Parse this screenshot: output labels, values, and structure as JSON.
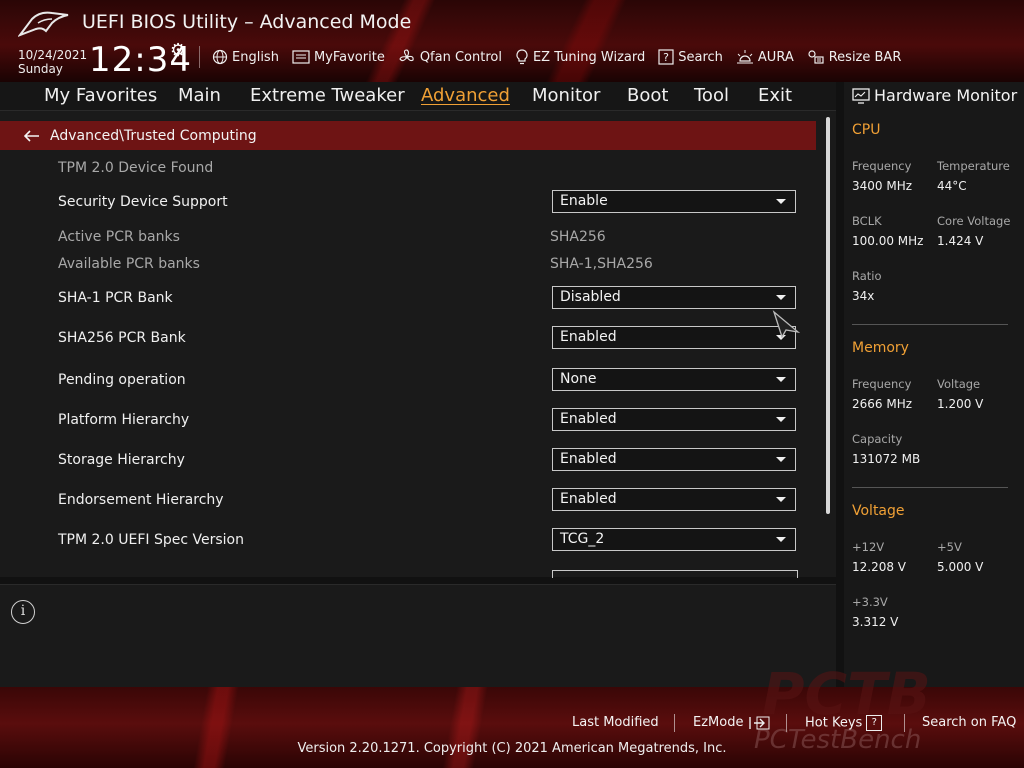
{
  "header": {
    "title": "UEFI BIOS Utility – Advanced Mode",
    "date": "10/24/2021",
    "day": "Sunday",
    "time": "12:34",
    "toolbar": [
      {
        "label": "English",
        "icon": "globe-icon"
      },
      {
        "label": "MyFavorite",
        "icon": "favorite-list-icon"
      },
      {
        "label": "Qfan Control",
        "icon": "fan-icon"
      },
      {
        "label": "EZ Tuning Wizard",
        "icon": "lightbulb-icon"
      },
      {
        "label": "Search",
        "icon": "help-search-icon"
      },
      {
        "label": "AURA",
        "icon": "aura-light-icon"
      },
      {
        "label": "Resize BAR",
        "icon": "resize-bar-icon"
      }
    ]
  },
  "tabs": [
    "My Favorites",
    "Main",
    "Extreme Tweaker",
    "Advanced",
    "Monitor",
    "Boot",
    "Tool",
    "Exit"
  ],
  "active_tab": "Advanced",
  "breadcrumb": "Advanced\\Trusted Computing",
  "settings": {
    "tpm_found": "TPM 2.0 Device Found",
    "security_device_support": {
      "label": "Security Device Support",
      "value": "Enable"
    },
    "active_pcr_banks": {
      "label": "Active PCR banks",
      "value": "SHA256"
    },
    "available_pcr_banks": {
      "label": "Available PCR banks",
      "value": "SHA-1,SHA256"
    },
    "sha1_pcr_bank": {
      "label": "SHA-1 PCR Bank",
      "value": "Disabled"
    },
    "sha256_pcr_bank": {
      "label": "SHA256 PCR Bank",
      "value": "Enabled"
    },
    "pending_operation": {
      "label": "Pending operation",
      "value": "None"
    },
    "platform_hierarchy": {
      "label": "Platform Hierarchy",
      "value": "Enabled"
    },
    "storage_hierarchy": {
      "label": "Storage Hierarchy",
      "value": "Enabled"
    },
    "endorsement_hierarchy": {
      "label": "Endorsement Hierarchy",
      "value": "Enabled"
    },
    "tpm_uefi_spec_version": {
      "label": "TPM 2.0 UEFI Spec Version",
      "value": "TCG_2"
    }
  },
  "hardware_monitor": {
    "title": "Hardware Monitor",
    "cpu": {
      "heading": "CPU",
      "frequency_label": "Frequency",
      "frequency": "3400 MHz",
      "temperature_label": "Temperature",
      "temperature": "44°C",
      "bclk_label": "BCLK",
      "bclk": "100.00 MHz",
      "core_voltage_label": "Core Voltage",
      "core_voltage": "1.424 V",
      "ratio_label": "Ratio",
      "ratio": "34x"
    },
    "memory": {
      "heading": "Memory",
      "frequency_label": "Frequency",
      "frequency": "2666 MHz",
      "voltage_label": "Voltage",
      "voltage": "1.200 V",
      "capacity_label": "Capacity",
      "capacity": "131072 MB"
    },
    "voltage": {
      "heading": "Voltage",
      "v12_label": "+12V",
      "v12": "12.208 V",
      "v5_label": "+5V",
      "v5": "5.000 V",
      "v33_label": "+3.3V",
      "v33": "3.312 V"
    }
  },
  "footer": {
    "last_modified": "Last Modified",
    "ezmode": "EzMode",
    "hot_keys": "Hot Keys",
    "hot_keys_key": "?",
    "search_faq": "Search on FAQ",
    "version": "Version 2.20.1271. Copyright (C) 2021 American Megatrends, Inc.",
    "watermark_big": "PCTB",
    "watermark_small": "PCTestBench"
  },
  "colors": {
    "accent": "#f0a035",
    "breadcrumb_bg": "#6e1414",
    "header_red": "#4a0a0a"
  }
}
